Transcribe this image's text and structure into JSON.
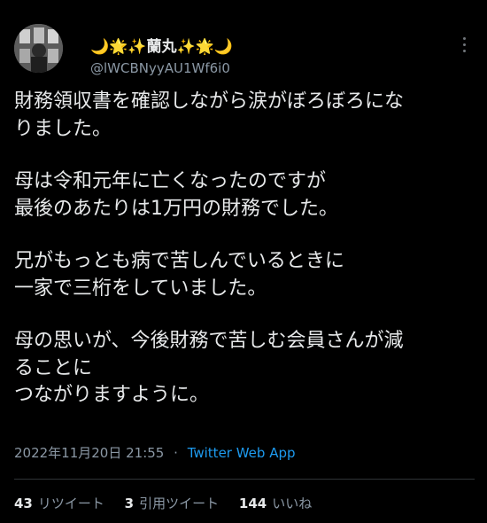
{
  "tweet": {
    "display_name": "🌙🌟✨蘭丸✨🌟🌙",
    "handle": "@lWCBNyyAU1Wf6i0",
    "paragraphs": [
      [
        "財務領収書を確認しながら涙がぼろぼろにな",
        "りました。"
      ],
      [
        "母は令和元年に亡くなったのですが",
        "最後のあたりは1万円の財務でした。"
      ],
      [
        "兄がもっとも病で苦しんでいるときに",
        "一家で三桁をしていました。"
      ],
      [
        "母の思いが、今後財務で苦しむ会員さんが減",
        "ることに",
        "つながりますように。"
      ]
    ],
    "timestamp": "2022年11月20日 21:55",
    "separator": "·",
    "source": "Twitter Web App",
    "retweets_count": "43",
    "retweets_label": "リツイート",
    "quotes_count": "3",
    "quotes_label": "引用ツイート",
    "likes_count": "144",
    "likes_label": "いいね"
  },
  "colors": {
    "background": "#000000",
    "text": "#e7e9ea",
    "secondary": "#8b98a5",
    "link": "#1d9bf0"
  },
  "icons": {
    "more": "more-dots-icon",
    "avatar": "avatar-image"
  }
}
